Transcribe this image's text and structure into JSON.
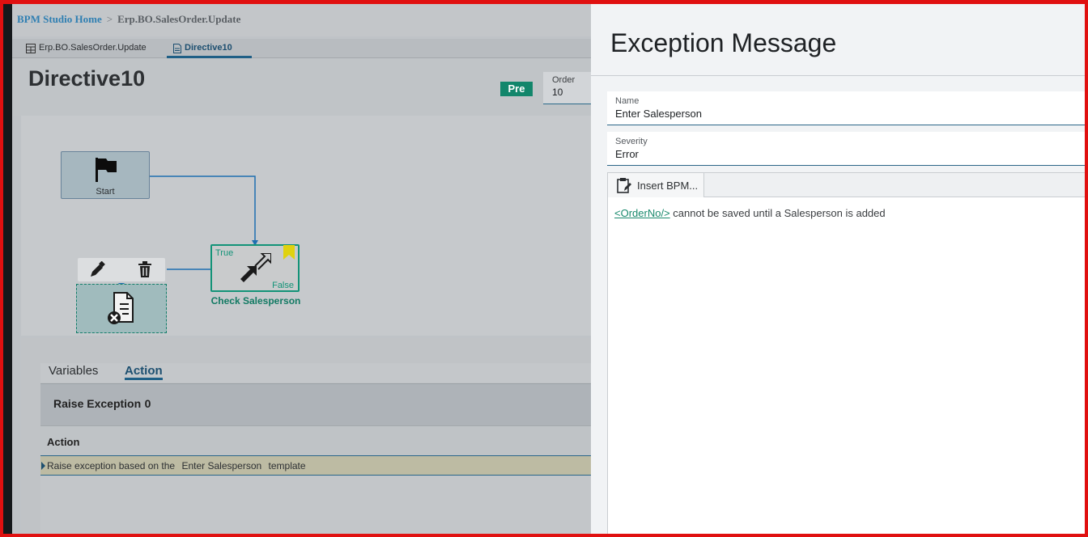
{
  "breadcrumb": {
    "home": "BPM Studio Home",
    "separator": ">",
    "current": "Erp.BO.SalesOrder.Update"
  },
  "tabs": [
    {
      "label": "Erp.BO.SalesOrder.Update",
      "icon": "table-icon"
    },
    {
      "label": "Directive10",
      "icon": "document-icon",
      "active": true
    }
  ],
  "directive": {
    "title": "Directive10",
    "badge": "Pre",
    "order_label": "Order",
    "order_value": "10"
  },
  "canvas": {
    "start_label": "Start",
    "check_label": "Check Salesperson",
    "true_label": "True",
    "false_label": "False"
  },
  "bottom": {
    "tabs": [
      "Variables",
      "Action"
    ],
    "active_tab": "Action",
    "section_title": "Raise Exception",
    "section_count": "0",
    "column_header": "Action",
    "row_prefix": "Raise exception based on the",
    "row_template": "Enter Salesperson",
    "row_suffix": "template"
  },
  "panel": {
    "title": "Exception Message",
    "name_label": "Name",
    "name_value": "Enter Salesperson",
    "severity_label": "Severity",
    "severity_value": "Error",
    "insert_button": "Insert BPM...",
    "message_tag": "<OrderNo/>",
    "message_text": " cannot be saved until a Salesperson is added"
  },
  "colors": {
    "accent": "#12866b",
    "link": "#2f7fb2",
    "border": "#e01010"
  }
}
